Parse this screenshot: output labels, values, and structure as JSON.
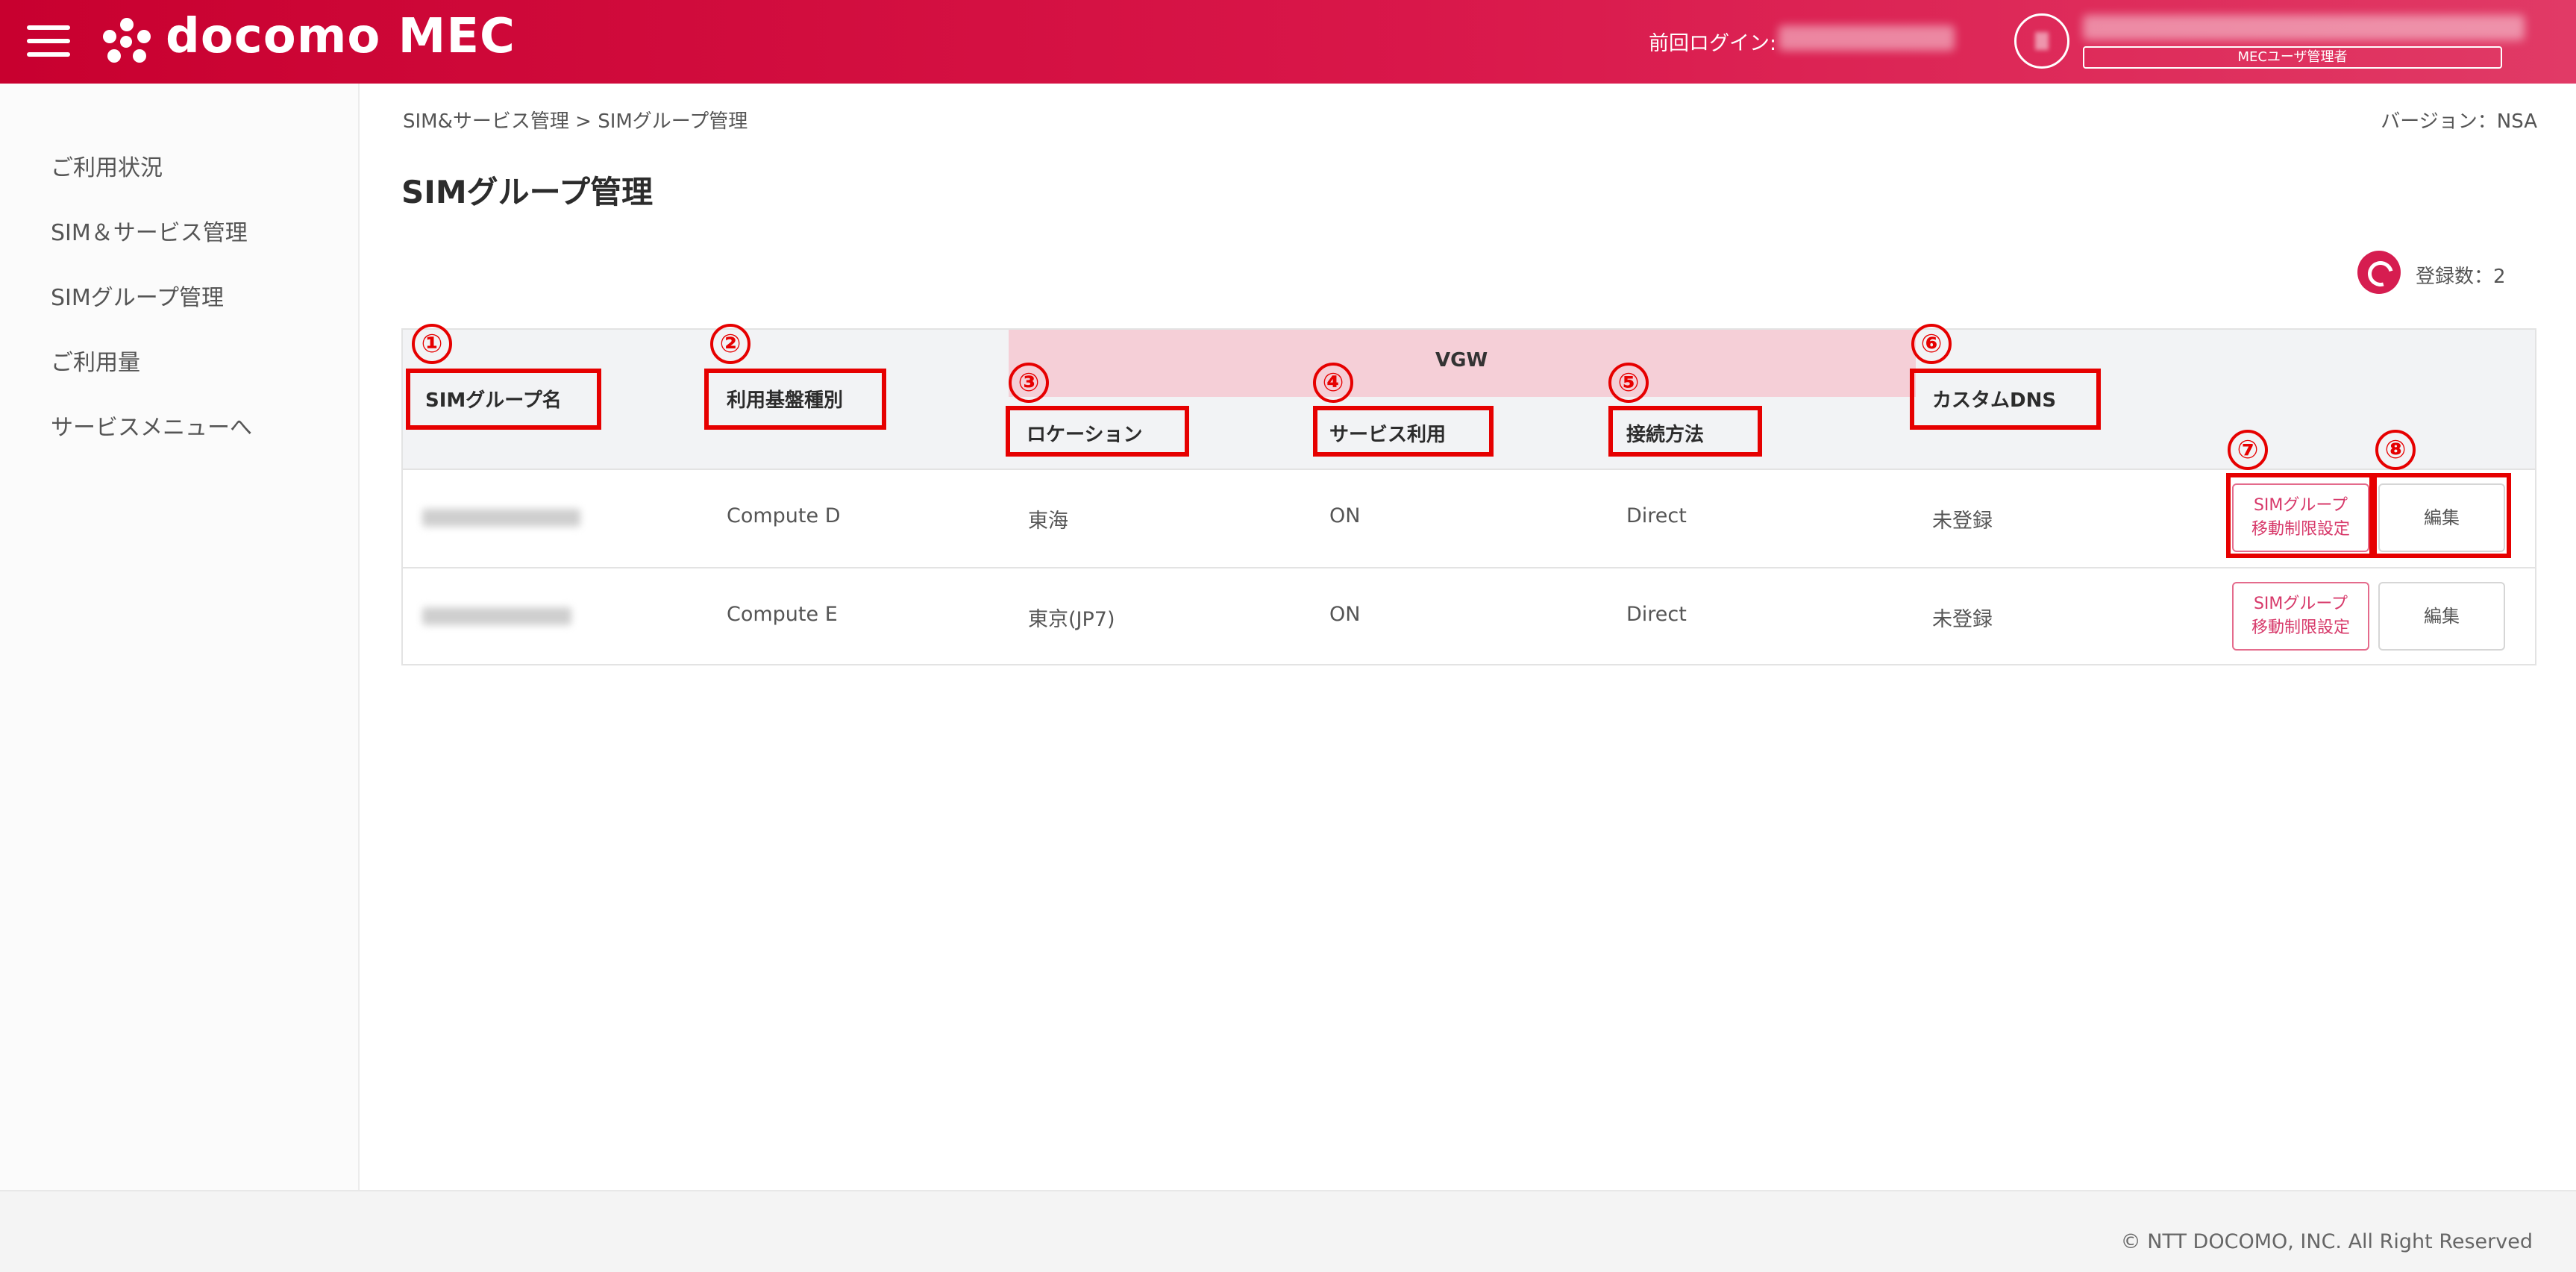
{
  "header": {
    "logo": "docomo MEC",
    "last_login_label": "前回ログイン:",
    "user_role": "MECユーザ管理者"
  },
  "sidebar": {
    "items": [
      {
        "label": "ご利用状況"
      },
      {
        "label": "SIM＆サービス管理"
      },
      {
        "label": "SIMグループ管理"
      },
      {
        "label": "ご利用量"
      },
      {
        "label": "サービスメニューへ"
      }
    ]
  },
  "main": {
    "breadcrumb": "SIM&サービス管理 > SIMグループ管理",
    "version": "バージョン：NSA",
    "title": "SIMグループ管理",
    "count_label": "登録数：2"
  },
  "table": {
    "group_header": "VGW",
    "columns": [
      "SIMグループ名",
      "利用基盤種別",
      "ロケーション",
      "サービス利用",
      "接続方法",
      "カスタムDNS"
    ],
    "rows": [
      {
        "platform": "Compute D",
        "location": "東海",
        "service": "ON",
        "connection": "Direct",
        "dns": "未登録",
        "sim_button": "SIMグループ\n移動制限設定",
        "edit_button": "編集"
      },
      {
        "platform": "Compute E",
        "location": "東京(JP7)",
        "service": "ON",
        "connection": "Direct",
        "dns": "未登録",
        "sim_button": "SIMグループ\n移動制限設定",
        "edit_button": "編集"
      }
    ]
  },
  "annotations": [
    "①",
    "②",
    "③",
    "④",
    "⑤",
    "⑥",
    "⑦",
    "⑧"
  ],
  "footer": {
    "copyright": "© NTT DOCOMO, INC. All Right Reserved"
  },
  "colors": {
    "brand": "#d61d50",
    "annotation": "#e60000",
    "vgw_band": "#f5cfd7"
  }
}
